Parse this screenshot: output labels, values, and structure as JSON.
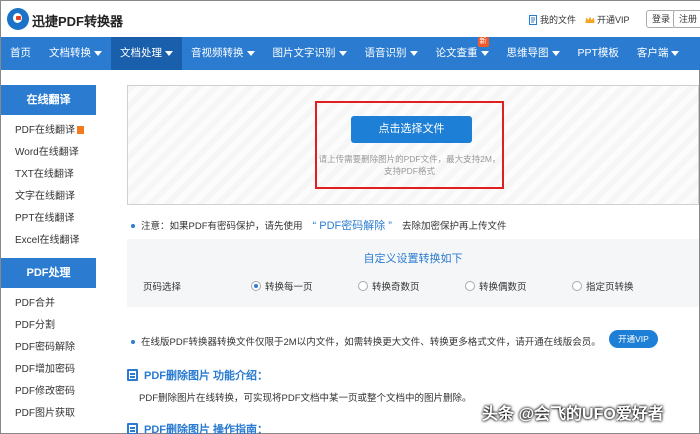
{
  "header": {
    "app_title": "迅捷PDF转换器",
    "my_files": "我的文件",
    "open_vip": "开通VIP",
    "login": "登录",
    "register": "注册"
  },
  "nav": {
    "items": [
      {
        "label": "首页",
        "caret": false
      },
      {
        "label": "文档转换",
        "caret": true
      },
      {
        "label": "文档处理",
        "caret": true,
        "active": true
      },
      {
        "label": "音视频转换",
        "caret": true
      },
      {
        "label": "图片文字识别",
        "caret": true
      },
      {
        "label": "语音识别",
        "caret": true
      },
      {
        "label": "论文查重",
        "caret": true,
        "badge": "新"
      },
      {
        "label": "思维导图",
        "caret": true
      },
      {
        "label": "PPT模板",
        "caret": false
      },
      {
        "label": "客户端",
        "caret": true
      }
    ]
  },
  "sidebar": {
    "translate_head": "在线翻译",
    "translate_items": [
      "PDF在线翻译",
      "Word在线翻译",
      "TXT在线翻译",
      "文字在线翻译",
      "PPT在线翻译",
      "Excel在线翻译"
    ],
    "pdf_head": "PDF处理",
    "pdf_items": [
      "PDF合并",
      "PDF分割",
      "PDF密码解除",
      "PDF增加密码",
      "PDF修改密码",
      "PDF图片获取"
    ]
  },
  "upload": {
    "button": "点击选择文件",
    "hint_line1": "请上传需要删除图片的PDF文件，最大支持2M，",
    "hint_line2": "支持PDF格式"
  },
  "notice": {
    "prefix": "注意：如果PDF有密码保护，请先使用",
    "link": "“ PDF密码解除 ”",
    "suffix": "去除加密保护再上传文件"
  },
  "settings": {
    "title": "自定义设置转换如下",
    "page_label": "页码选择",
    "options": [
      {
        "label": "转换每一页",
        "selected": true
      },
      {
        "label": "转换奇数页",
        "selected": false
      },
      {
        "label": "转换偶数页",
        "selected": false
      },
      {
        "label": "指定页转换",
        "selected": false
      }
    ]
  },
  "vip": {
    "text": "在线版PDF转换器转换文件仅限于2M以内文件，如需转换更大文件、转换更多格式文件，请开通在线版会员。",
    "button": "开通VIP"
  },
  "sections": {
    "intro_title": "PDF删除图片 功能介绍：",
    "intro_body": "PDF删除图片在线转换，可实现将PDF文档中某一页或整个文档中的图片删除。",
    "guide_title": "PDF删除图片 操作指南："
  },
  "watermark": "头条 @会飞的UFO爱好者",
  "colors": {
    "primary": "#2b7cd1",
    "nav_active": "#1a5fab",
    "highlight_border": "#e02020"
  }
}
